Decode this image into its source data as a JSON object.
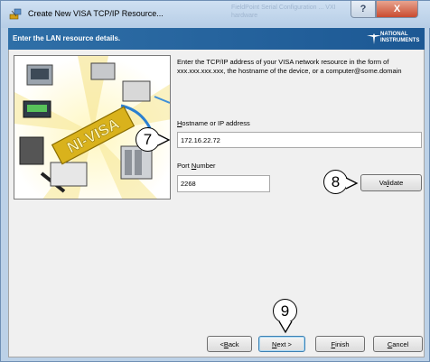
{
  "window": {
    "title": "Create New VISA TCP/IP Resource...",
    "background_window_text": "FieldPoint Serial Configuration ... VXI hardware",
    "help_label": "?",
    "close_label": "X"
  },
  "header": {
    "text": "Enter the LAN resource details.",
    "logo": "NATIONAL\nINSTRUMENTS"
  },
  "illustration": {
    "label": "NI-VISA"
  },
  "description": "Enter the TCP/IP address of your VISA network resource in the form of xxx.xxx.xxx.xxx, the hostname of the device, or a computer@some.domain",
  "hostname": {
    "label_pre": "",
    "label_accel": "H",
    "label_post": "ostname or IP address",
    "value": "172.16.22.72"
  },
  "port": {
    "label_pre": "Port ",
    "label_accel": "N",
    "label_post": "umber",
    "value": "2268"
  },
  "buttons": {
    "validate_pre": "Va",
    "validate_accel": "l",
    "validate_post": "idate",
    "back_pre": "< ",
    "back_accel": "B",
    "back_post": "ack",
    "next_pre": "",
    "next_accel": "N",
    "next_post": "ext >",
    "finish_pre": "",
    "finish_accel": "F",
    "finish_post": "inish",
    "cancel_pre": "",
    "cancel_accel": "C",
    "cancel_post": "ancel"
  },
  "callouts": {
    "c7": "7",
    "c8": "8",
    "c9": "9"
  },
  "colors": {
    "header": "#1c5894",
    "close_button": "#c94b2f",
    "illustration_banner": "#d9b21c"
  }
}
